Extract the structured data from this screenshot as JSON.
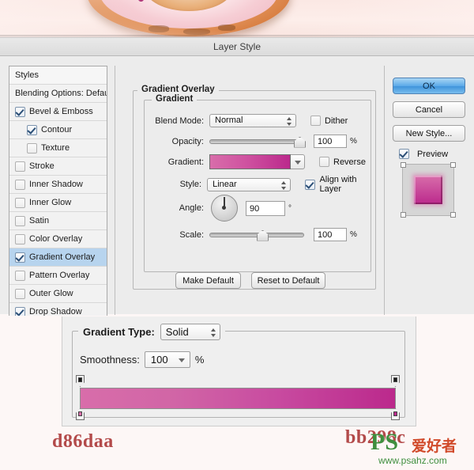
{
  "window": {
    "title": "Layer Style"
  },
  "photo": {
    "alt_name": "donut-photo"
  },
  "styles_panel": {
    "header": "Styles",
    "blending_options": "Blending Options: Default",
    "items": [
      {
        "label": "Bevel & Emboss",
        "checked": true,
        "indent": false
      },
      {
        "label": "Contour",
        "checked": true,
        "indent": true
      },
      {
        "label": "Texture",
        "checked": false,
        "indent": true
      },
      {
        "label": "Stroke",
        "checked": false,
        "indent": false
      },
      {
        "label": "Inner Shadow",
        "checked": false,
        "indent": false
      },
      {
        "label": "Inner Glow",
        "checked": false,
        "indent": false
      },
      {
        "label": "Satin",
        "checked": false,
        "indent": false
      },
      {
        "label": "Color Overlay",
        "checked": false,
        "indent": false
      },
      {
        "label": "Gradient Overlay",
        "checked": true,
        "indent": false,
        "selected": true
      },
      {
        "label": "Pattern Overlay",
        "checked": false,
        "indent": false
      },
      {
        "label": "Outer Glow",
        "checked": false,
        "indent": false
      },
      {
        "label": "Drop Shadow",
        "checked": true,
        "indent": false
      }
    ]
  },
  "gradient_overlay": {
    "section_title": "Gradient Overlay",
    "group_title": "Gradient",
    "blend_mode_label": "Blend Mode:",
    "blend_mode_value": "Normal",
    "dither_label": "Dither",
    "dither_checked": false,
    "opacity_label": "Opacity:",
    "opacity_value": "100",
    "opacity_unit": "%",
    "gradient_label": "Gradient:",
    "reverse_label": "Reverse",
    "reverse_checked": false,
    "style_label": "Style:",
    "style_value": "Linear",
    "align_label": "Align with Layer",
    "align_checked": true,
    "angle_label": "Angle:",
    "angle_value": "90",
    "angle_unit": "°",
    "scale_label": "Scale:",
    "scale_value": "100",
    "scale_unit": "%",
    "make_default": "Make Default",
    "reset_to_default": "Reset to Default"
  },
  "buttons": {
    "ok": "OK",
    "cancel": "Cancel",
    "new_style": "New Style...",
    "preview_label": "Preview",
    "preview_checked": true
  },
  "gradient_editor": {
    "type_label": "Gradient Type:",
    "type_value": "Solid",
    "smoothness_label": "Smoothness:",
    "smoothness_value": "100",
    "smoothness_unit": "%"
  },
  "colors": {
    "left_hex": "d86daa",
    "right_hex": "bb298c",
    "gradient_start": "#d86daa",
    "gradient_end": "#bb298c",
    "hex_text_color": "#b34a4a",
    "selection_blue": "#b7d4ee",
    "ok_button_blue": "#5aa9e8"
  },
  "watermark": {
    "brand": "PS",
    "brand_cn": "爱好者",
    "url": "www.psahz.com"
  }
}
